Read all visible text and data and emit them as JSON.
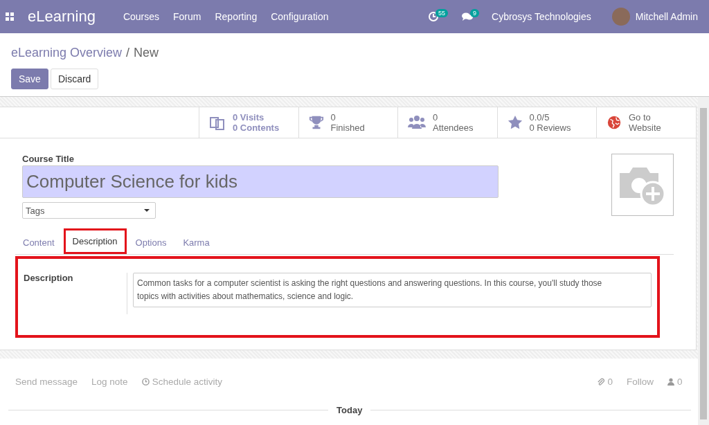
{
  "navbar": {
    "app_name": "eLearning",
    "menu": [
      "Courses",
      "Forum",
      "Reporting",
      "Configuration"
    ],
    "activity_count": "55",
    "message_count": "9",
    "company": "Cybrosys Technologies",
    "user": "Mitchell Admin"
  },
  "breadcrumb": {
    "parent": "eLearning Overview",
    "separator": "/",
    "current": "New"
  },
  "actions": [
    "Save",
    "Discard"
  ],
  "stat_buttons": [
    {
      "kind": "contents",
      "line_1": "0 Visits",
      "line_2": "0 Contents"
    },
    {
      "kind": "trophy",
      "line_1": "0",
      "line_2": "Finished"
    },
    {
      "kind": "people",
      "line_1": "0",
      "line_2": "Attendees"
    },
    {
      "kind": "star",
      "line_1": "0.0/5",
      "line_2": "0 Reviews"
    },
    {
      "kind": "globe",
      "line_1": "Go to",
      "line_2": "Website"
    }
  ],
  "form": {
    "title_label": "Course Title",
    "title_value": "Computer Science for kids",
    "tags_placeholder": "Tags"
  },
  "tabs": [
    {
      "label": "Content",
      "selected": false,
      "highlighted": false
    },
    {
      "label": "Description",
      "selected": true,
      "highlighted": true
    },
    {
      "label": "Options",
      "selected": false,
      "highlighted": false
    },
    {
      "label": "Karma",
      "selected": false,
      "highlighted": false
    }
  ],
  "description": {
    "label": "Description",
    "value": "Common tasks for a computer scientist is asking the right questions and answering questions. In this course, you'll study those topics with activities about mathematics, science and logic.",
    "highlighted": true
  },
  "chatter": {
    "left": [
      {
        "kind": "plain",
        "label": "Send message"
      },
      {
        "kind": "plain",
        "label": "Log note"
      },
      {
        "kind": "clock",
        "label": "Schedule activity"
      }
    ],
    "attachments": "0",
    "follow": "Follow",
    "followers": "0",
    "separator": "Today"
  }
}
